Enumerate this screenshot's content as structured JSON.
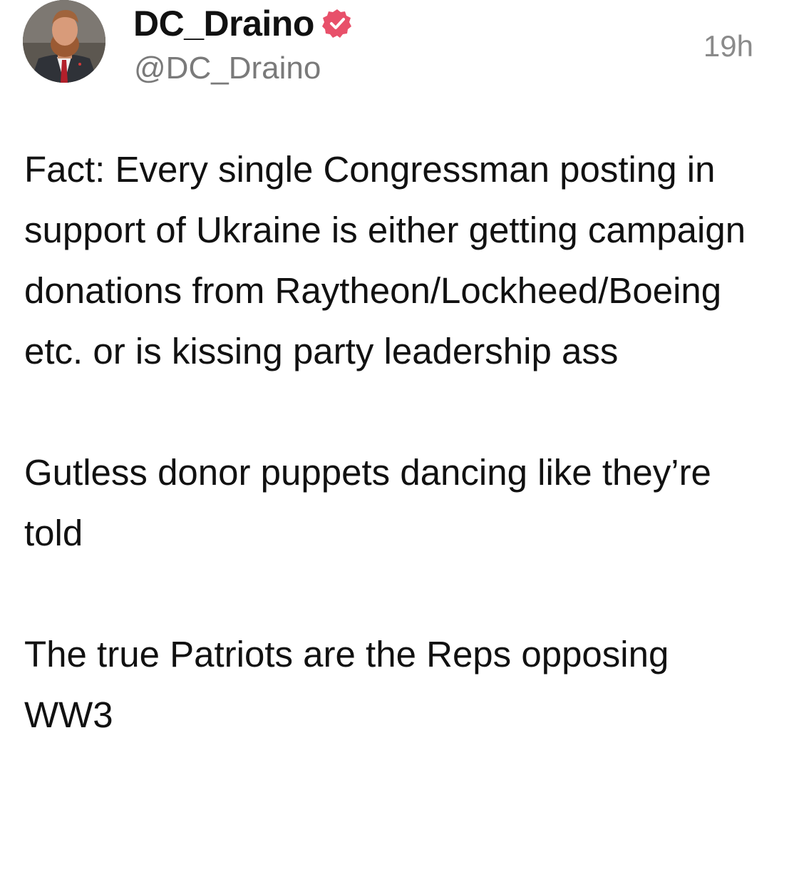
{
  "author": {
    "display_name": "DC_Draino",
    "handle": "@DC_Draino",
    "verified_icon": "verified-badge-icon",
    "verified_color": "#e8506a"
  },
  "timestamp": "19h",
  "post": {
    "paragraphs": [
      "Fact: Every single Congressman posting in support of Ukraine is either getting campaign donations from Raytheon/Lockheed/Boeing etc. or is kissing party leadership ass",
      "Gutless donor puppets dancing like they’re told",
      "The true Patriots are the Reps opposing WW3"
    ]
  }
}
